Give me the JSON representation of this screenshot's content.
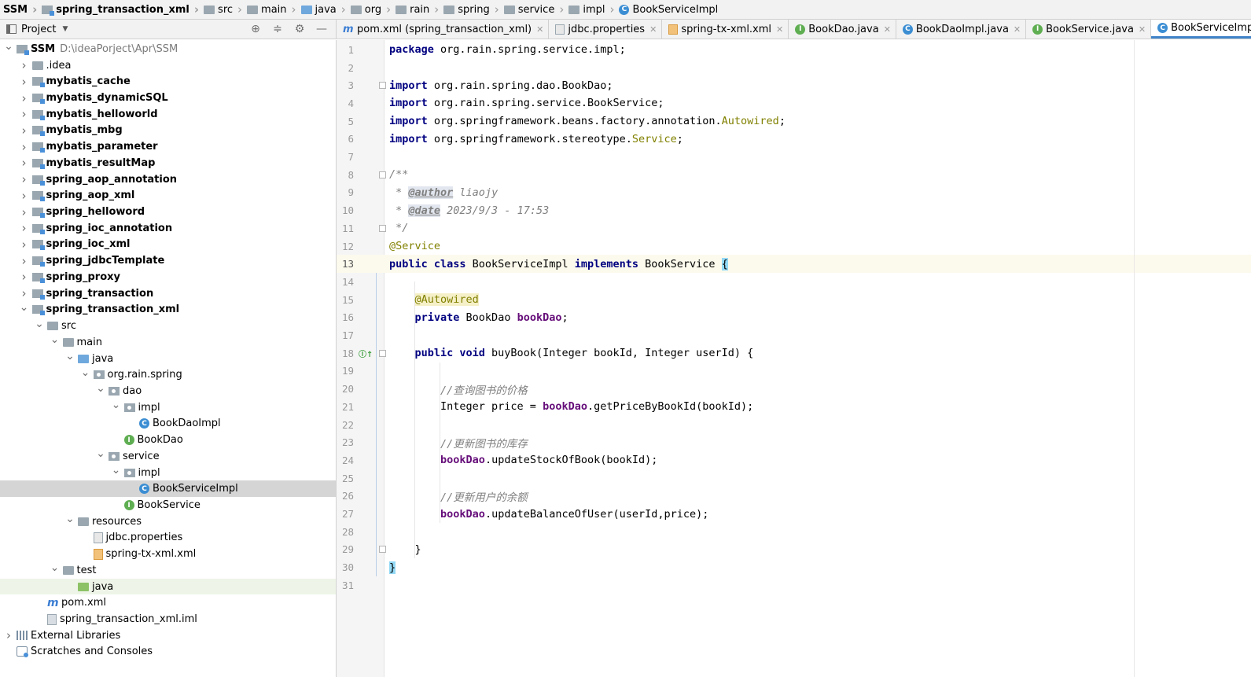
{
  "breadcrumb": [
    {
      "label": "SSM",
      "icon": "none",
      "bold": true
    },
    {
      "label": "spring_transaction_xml",
      "icon": "module-icon",
      "bold": true
    },
    {
      "label": "src",
      "icon": "folder-icon"
    },
    {
      "label": "main",
      "icon": "folder-icon"
    },
    {
      "label": "java",
      "icon": "source-folder-icon"
    },
    {
      "label": "org",
      "icon": "package-icon"
    },
    {
      "label": "rain",
      "icon": "package-icon"
    },
    {
      "label": "spring",
      "icon": "package-icon"
    },
    {
      "label": "service",
      "icon": "package-icon"
    },
    {
      "label": "impl",
      "icon": "package-icon"
    },
    {
      "label": "BookServiceImpl",
      "icon": "class-icon"
    }
  ],
  "project_panel": {
    "title": "Project",
    "tools": [
      "locate-icon",
      "collapse-all-icon",
      "gear-icon",
      "minimize-icon"
    ]
  },
  "tree": [
    {
      "label": "SSM",
      "path": "D:\\ideaPorject\\Apr\\SSM",
      "indent": 0,
      "arrow": "down",
      "icon": "module",
      "bold": true
    },
    {
      "label": ".idea",
      "indent": 1,
      "arrow": "right",
      "icon": "folder"
    },
    {
      "label": "mybatis_cache",
      "indent": 1,
      "arrow": "right",
      "icon": "module",
      "bold": true
    },
    {
      "label": "mybatis_dynamicSQL",
      "indent": 1,
      "arrow": "right",
      "icon": "module",
      "bold": true
    },
    {
      "label": "mybatis_helloworld",
      "indent": 1,
      "arrow": "right",
      "icon": "module",
      "bold": true
    },
    {
      "label": "mybatis_mbg",
      "indent": 1,
      "arrow": "right",
      "icon": "module",
      "bold": true
    },
    {
      "label": "mybatis_parameter",
      "indent": 1,
      "arrow": "right",
      "icon": "module",
      "bold": true
    },
    {
      "label": "mybatis_resultMap",
      "indent": 1,
      "arrow": "right",
      "icon": "module",
      "bold": true
    },
    {
      "label": "spring_aop_annotation",
      "indent": 1,
      "arrow": "right",
      "icon": "module",
      "bold": true
    },
    {
      "label": "spring_aop_xml",
      "indent": 1,
      "arrow": "right",
      "icon": "module",
      "bold": true
    },
    {
      "label": "spring_helloword",
      "indent": 1,
      "arrow": "right",
      "icon": "module",
      "bold": true
    },
    {
      "label": "spring_ioc_annotation",
      "indent": 1,
      "arrow": "right",
      "icon": "module",
      "bold": true
    },
    {
      "label": "spring_ioc_xml",
      "indent": 1,
      "arrow": "right",
      "icon": "module",
      "bold": true
    },
    {
      "label": "spring_jdbcTemplate",
      "indent": 1,
      "arrow": "right",
      "icon": "module",
      "bold": true
    },
    {
      "label": "spring_proxy",
      "indent": 1,
      "arrow": "right",
      "icon": "module",
      "bold": true
    },
    {
      "label": "spring_transaction",
      "indent": 1,
      "arrow": "right",
      "icon": "module",
      "bold": true
    },
    {
      "label": "spring_transaction_xml",
      "indent": 1,
      "arrow": "down",
      "icon": "module",
      "bold": true
    },
    {
      "label": "src",
      "indent": 2,
      "arrow": "down",
      "icon": "folder"
    },
    {
      "label": "main",
      "indent": 3,
      "arrow": "down",
      "icon": "folder"
    },
    {
      "label": "java",
      "indent": 4,
      "arrow": "down",
      "icon": "source-folder"
    },
    {
      "label": "org.rain.spring",
      "indent": 5,
      "arrow": "down",
      "icon": "package"
    },
    {
      "label": "dao",
      "indent": 6,
      "arrow": "down",
      "icon": "package"
    },
    {
      "label": "impl",
      "indent": 7,
      "arrow": "down",
      "icon": "package"
    },
    {
      "label": "BookDaoImpl",
      "indent": 8,
      "arrow": "none",
      "icon": "class"
    },
    {
      "label": "BookDao",
      "indent": 7,
      "arrow": "none",
      "icon": "interface"
    },
    {
      "label": "service",
      "indent": 6,
      "arrow": "down",
      "icon": "package"
    },
    {
      "label": "impl",
      "indent": 7,
      "arrow": "down",
      "icon": "package"
    },
    {
      "label": "BookServiceImpl",
      "indent": 8,
      "arrow": "none",
      "icon": "class",
      "selected": true
    },
    {
      "label": "BookService",
      "indent": 7,
      "arrow": "none",
      "icon": "interface"
    },
    {
      "label": "resources",
      "indent": 4,
      "arrow": "down",
      "icon": "resources-folder"
    },
    {
      "label": "jdbc.properties",
      "indent": 5,
      "arrow": "none",
      "icon": "properties"
    },
    {
      "label": "spring-tx-xml.xml",
      "indent": 5,
      "arrow": "none",
      "icon": "xml"
    },
    {
      "label": "test",
      "indent": 3,
      "arrow": "down",
      "icon": "folder"
    },
    {
      "label": "java",
      "indent": 4,
      "arrow": "none",
      "icon": "test-folder",
      "highlight": true
    },
    {
      "label": "pom.xml",
      "indent": 2,
      "arrow": "none",
      "icon": "maven"
    },
    {
      "label": "spring_transaction_xml.iml",
      "indent": 2,
      "arrow": "none",
      "icon": "iml"
    },
    {
      "label": "External Libraries",
      "indent": 0,
      "arrow": "right",
      "icon": "library"
    },
    {
      "label": "Scratches and Consoles",
      "indent": 0,
      "arrow": "none",
      "icon": "scratch"
    }
  ],
  "tabs": [
    {
      "label": "pom.xml (spring_transaction_xml)",
      "icon": "maven",
      "active": false
    },
    {
      "label": "jdbc.properties",
      "icon": "properties",
      "active": false
    },
    {
      "label": "spring-tx-xml.xml",
      "icon": "xml",
      "active": false
    },
    {
      "label": "BookDao.java",
      "icon": "interface",
      "active": false
    },
    {
      "label": "BookDaoImpl.java",
      "icon": "class",
      "active": false
    },
    {
      "label": "BookService.java",
      "icon": "interface",
      "active": false
    },
    {
      "label": "BookServiceImpl.java",
      "icon": "class",
      "active": true
    }
  ],
  "editor": {
    "current_line": 13,
    "lines": [
      [
        {
          "t": "package",
          "c": "kw"
        },
        {
          "t": " org.rain.spring.service.impl;"
        }
      ],
      [],
      [
        {
          "t": "import",
          "c": "kw"
        },
        {
          "t": " org.rain.spring.dao.BookDao;"
        }
      ],
      [
        {
          "t": "import",
          "c": "kw"
        },
        {
          "t": " org.rain.spring.service.BookService;"
        }
      ],
      [
        {
          "t": "import",
          "c": "kw"
        },
        {
          "t": " org.springframework.beans.factory.annotation."
        },
        {
          "t": "Autowired",
          "c": "ann"
        },
        {
          "t": ";"
        }
      ],
      [
        {
          "t": "import",
          "c": "kw"
        },
        {
          "t": " org.springframework.stereotype."
        },
        {
          "t": "Service",
          "c": "ann"
        },
        {
          "t": ";"
        }
      ],
      [],
      [
        {
          "t": "/**",
          "c": "doc"
        }
      ],
      [
        {
          "t": " * ",
          "c": "doc"
        },
        {
          "t": "@author",
          "c": "doctag"
        },
        {
          "t": " liaojy",
          "c": "doc"
        }
      ],
      [
        {
          "t": " * ",
          "c": "doc"
        },
        {
          "t": "@date",
          "c": "doctag"
        },
        {
          "t": " 2023/9/3 - 17:53",
          "c": "doc"
        }
      ],
      [
        {
          "t": " */",
          "c": "doc"
        }
      ],
      [
        {
          "t": "@Service",
          "c": "ann"
        }
      ],
      [
        {
          "t": "public class",
          "c": "kw"
        },
        {
          "t": " BookServiceImpl "
        },
        {
          "t": "implements",
          "c": "kw"
        },
        {
          "t": " BookService "
        },
        {
          "t": "{",
          "c": "brace-hl"
        }
      ],
      [],
      [
        {
          "t": "    "
        },
        {
          "t": "@Autowired",
          "c": "ann-bg"
        }
      ],
      [
        {
          "t": "    "
        },
        {
          "t": "private",
          "c": "kw"
        },
        {
          "t": " BookDao "
        },
        {
          "t": "bookDao",
          "c": "field"
        },
        {
          "t": ";"
        }
      ],
      [],
      [
        {
          "t": "    "
        },
        {
          "t": "public void",
          "c": "kw"
        },
        {
          "t": " buyBook(Integer bookId, Integer userId) {"
        }
      ],
      [],
      [
        {
          "t": "        "
        },
        {
          "t": "//查询图书的价格",
          "c": "cmt"
        }
      ],
      [
        {
          "t": "        Integer price = "
        },
        {
          "t": "bookDao",
          "c": "field"
        },
        {
          "t": ".getPriceByBookId(bookId);"
        }
      ],
      [],
      [
        {
          "t": "        "
        },
        {
          "t": "//更新图书的库存",
          "c": "cmt"
        }
      ],
      [
        {
          "t": "        "
        },
        {
          "t": "bookDao",
          "c": "field"
        },
        {
          "t": ".updateStockOfBook(bookId);"
        }
      ],
      [],
      [
        {
          "t": "        "
        },
        {
          "t": "//更新用户的余额",
          "c": "cmt"
        }
      ],
      [
        {
          "t": "        "
        },
        {
          "t": "bookDao",
          "c": "field"
        },
        {
          "t": ".updateBalanceOfUser(userId,price);"
        }
      ],
      [],
      [
        {
          "t": "    }"
        }
      ],
      [
        {
          "t": "}",
          "c": "brace-hl"
        }
      ],
      []
    ],
    "fold_lines": [
      3,
      8,
      11,
      18,
      29
    ],
    "gutter_icons": [
      {
        "line": 18,
        "icon": "implements-method-icon",
        "glyph": "Ⓘ↑"
      }
    ]
  }
}
